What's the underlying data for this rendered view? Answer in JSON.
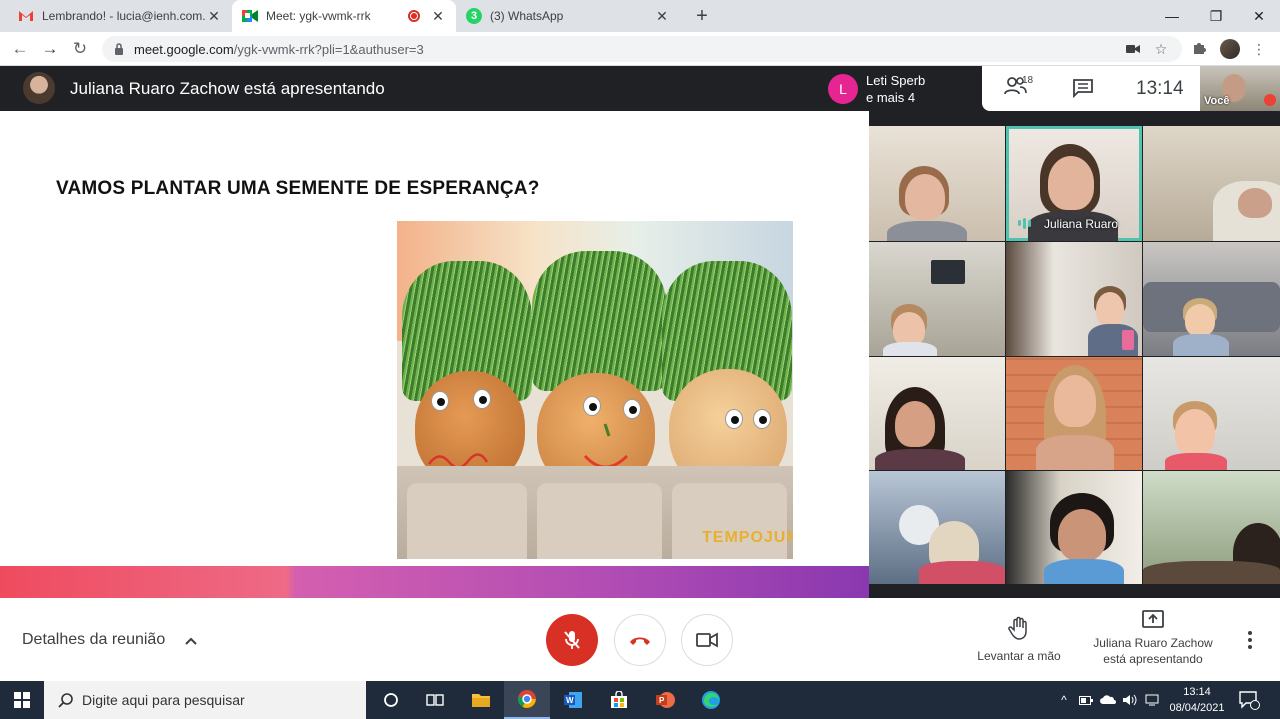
{
  "browser": {
    "tabs": [
      {
        "title": "Lembrando! - lucia@ienh.com.br",
        "favicon": "gmail-icon"
      },
      {
        "title": "Meet: ygk-vwmk-rrk",
        "favicon": "meet-icon",
        "active": true,
        "recording": true
      },
      {
        "title": "(3) WhatsApp",
        "favicon": "whatsapp-icon",
        "badge": "3"
      }
    ],
    "new_tab": "+",
    "url_host": "meet.google.com",
    "url_path": "/ygk-vwmk-rrk?pli=1&authuser=3"
  },
  "meet": {
    "presenting_title": "Juliana Ruaro Zachow está apresentando",
    "speaker_initial": "L",
    "speaker_line1": "Leti Sperb",
    "speaker_line2": "e mais 4",
    "participants_count": "18",
    "clock": "13:14",
    "self_label": "Você"
  },
  "slide": {
    "heading": "VAMOS PLANTAR UMA SEMENTE DE ESPERANÇA?",
    "watermark": "TEMPOJUNTO"
  },
  "grid": {
    "speaking_name": "Juliana Ruaro"
  },
  "controls": {
    "details": "Detalhes da reunião",
    "raise_hand": "Levantar a mão",
    "presenting_line1": "Juliana Ruaro Zachow",
    "presenting_line2": "está apresentando"
  },
  "taskbar": {
    "search_placeholder": "Digite aqui para pesquisar",
    "time": "13:14",
    "date": "08/04/2021"
  },
  "colors": {
    "meet_red": "#d93025",
    "speaker_pink": "#e52592",
    "speaking_teal": "#4fc3b0"
  }
}
